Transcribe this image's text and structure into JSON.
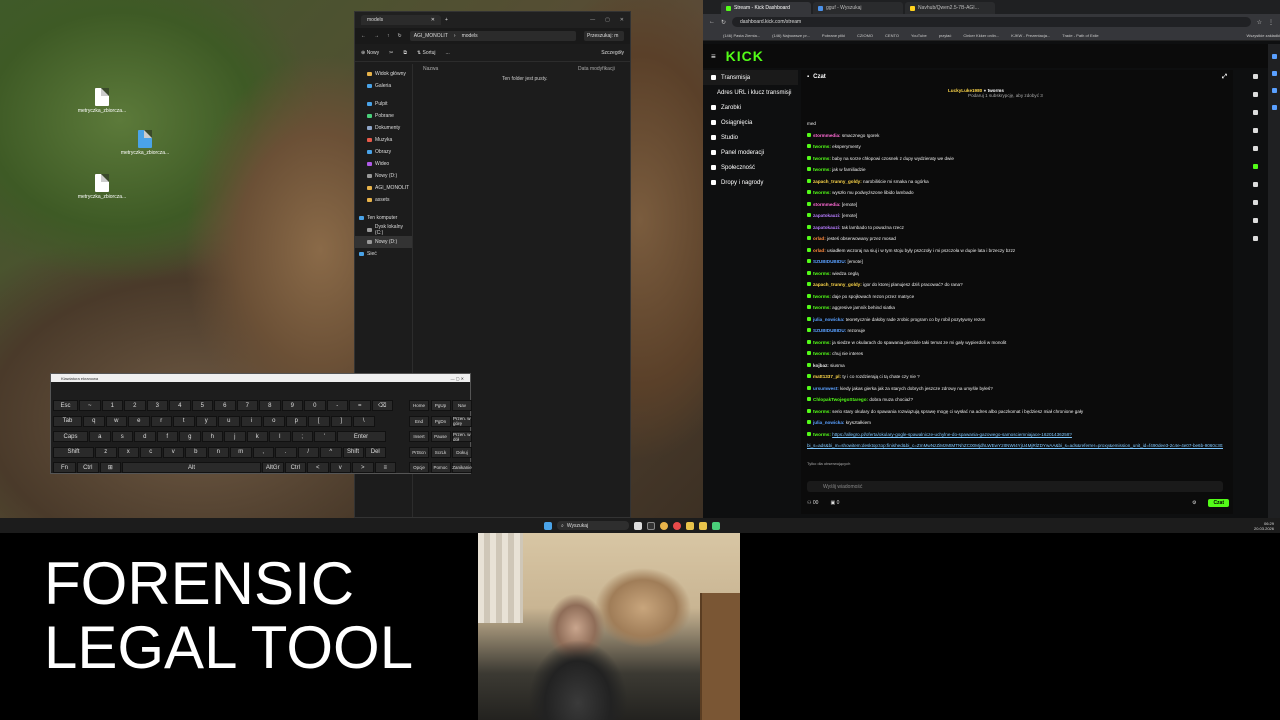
{
  "desktop": {
    "icons": [
      {
        "label": "metryczka_zbiorcza..."
      },
      {
        "label": "metryczka_zbiorcza..."
      },
      {
        "label": "metryczka_zbiorcza..."
      }
    ]
  },
  "explorer": {
    "tab_title": "models",
    "path": [
      "AGI_MONOLIT",
      "models"
    ],
    "search_placeholder": "Przeszukaj: m",
    "toolbar": {
      "new": "Nowy",
      "sort": "Sortuj",
      "more": "...",
      "details": "Szczegóły"
    },
    "sidebar": [
      "Widok główny",
      "Galeria",
      "Pulpit",
      "Pobrane",
      "Dokumenty",
      "Muzyka",
      "Obrazy",
      "Wideo",
      "Nowy (D:)",
      "AGI_MONOLIT",
      "assets",
      "Ten komputer",
      "Dysk lokalny (C:)",
      "Nowy (D:)",
      "Sieć"
    ],
    "columns": {
      "name": "Nazwa",
      "date": "Data modyfikacji"
    },
    "empty_text": "Ten folder jest pusty."
  },
  "keyboard": {
    "title": "Klawiatura ekranowa",
    "row1": [
      "Esc",
      "~",
      "1",
      "2",
      "3",
      "4",
      "5",
      "6",
      "7",
      "8",
      "9",
      "0",
      "-",
      "=",
      "⌫"
    ],
    "row2": [
      "Tab",
      "q",
      "w",
      "e",
      "r",
      "t",
      "y",
      "u",
      "i",
      "o",
      "p",
      "[",
      "]",
      "\\"
    ],
    "row3": [
      "Caps",
      "a",
      "s",
      "d",
      "f",
      "g",
      "h",
      "j",
      "k",
      "l",
      ";",
      "'",
      "Enter"
    ],
    "row4": [
      "Shift",
      "z",
      "x",
      "c",
      "v",
      "b",
      "n",
      "m",
      ",",
      ".",
      "/",
      "^",
      "Shift",
      "Del"
    ],
    "row5": [
      "Fn",
      "Ctrl",
      "⊞",
      "Alt",
      "AltGr",
      "Ctrl",
      "<",
      "v",
      ">",
      "≡"
    ],
    "nav": [
      "Home",
      "PgUp",
      "Nav",
      "End",
      "PgDn",
      "Przen. w górę",
      "Insert",
      "Pause",
      "Przen. w dół",
      "PrtScn",
      "ScrLk",
      "Dokuj",
      "Opcje",
      "Pomoc",
      "Zanikanie"
    ]
  },
  "browser": {
    "tabs": [
      "Stream - Kick Dashboard",
      "gguf - Wyszukaj",
      "Navhub/Qwen2.5-7B-AGI..."
    ],
    "url": "dashboard.kick.com/stream",
    "bookmarks": [
      "(146) Pasta Ziemia...",
      "(146) Najnowsze pr...",
      "Pobrane pliki",
      "CZIOMO",
      "CENTO",
      "YouTube",
      "przyłać",
      "Cinker Kkker onlin...",
      "KJKW - Prezentacja...",
      "Trade - Path of Exile",
      "Wszystkie zakładki"
    ],
    "sidebar": [
      "Transmisja",
      "Adres URL i klucz transmisji",
      "Zarobki",
      "Osiągnięcia",
      "Studio",
      "Panel moderacji",
      "Społeczność",
      "Dropy i nagrody"
    ],
    "chat_title": "Czat",
    "pinned": {
      "user": "LuckyLuke1980",
      "target": "tworms",
      "text": "Podaruj 1 subskrypcję, aby zdobyć 3"
    },
    "messages": [
      {
        "user": "",
        "text": "med",
        "color": "#e8e8e8"
      },
      {
        "user": "stormmedia:",
        "text": "smacznego Igorek",
        "color": "#ff6bd5"
      },
      {
        "user": "tworms:",
        "text": "eksperymenty",
        "color": "#53fc18"
      },
      {
        "user": "tworms:",
        "text": "baby na sorze chłopowi czosnek z dupy wydzieraty we dwie",
        "color": "#53fc18"
      },
      {
        "user": "tworms:",
        "text": "jak w familiadzie",
        "color": "#53fc18"
      },
      {
        "user": "zapach_trunny_goldy:",
        "text": "narobiliście mi smaka na ogórka",
        "color": "#ffd84a"
      },
      {
        "user": "tworms:",
        "text": "wyszło mu podwyższone libido lambado",
        "color": "#53fc18"
      },
      {
        "user": "stormmedia:",
        "text": "[emote]",
        "color": "#ff6bd5"
      },
      {
        "user": "zapatokauzi:",
        "text": "[emote]",
        "color": "#b77cff"
      },
      {
        "user": "zapatokauzi:",
        "text": "tak lambado to poważna rzecz",
        "color": "#b77cff"
      },
      {
        "user": "orlad:",
        "text": "jesteś obserwowany przez mosad",
        "color": "#ff8a3d"
      },
      {
        "user": "orlad:",
        "text": "usiadłem wczoraj na siuj i w tym stoju były pszczoły i mi pszczoła w dupie lata i brzeczy bzzz",
        "color": "#ff8a3d"
      },
      {
        "user": "SZUBIDUBIDU:",
        "text": "[emote]",
        "color": "#5aa0ff"
      },
      {
        "user": "tworms:",
        "text": "wiedza ceglą",
        "color": "#53fc18"
      },
      {
        "user": "zapach_trunny_goldy:",
        "text": "igor do ktorej planujesz dziś pracować? do rana?",
        "color": "#ffd84a"
      },
      {
        "user": "tworms:",
        "text": "daje po spojłowach rezon przez matryce",
        "color": "#53fc18"
      },
      {
        "user": "tworms:",
        "text": "aggresive jamnik behind siatka",
        "color": "#53fc18"
      },
      {
        "user": "julia_nowicka:",
        "text": "teoretycznie dałoby rade zrobic program co by robil pozytywny rezon",
        "color": "#5aa0ff"
      },
      {
        "user": "SZUBIDUBIDU:",
        "text": "rezonuje",
        "color": "#5aa0ff"
      },
      {
        "user": "tworms:",
        "text": "ja siedze w okularach do spawania pierdole taki temat ze mi gały wypierdoli w monolit",
        "color": "#53fc18"
      },
      {
        "user": "tworms:",
        "text": "chuj nie interes",
        "color": "#53fc18"
      },
      {
        "user": "kojbaz:",
        "text": "siusma",
        "color": "#e8e8e8"
      },
      {
        "user": "matt1337_pl:",
        "text": "ty i co rozdzierają ci tą chate czy nie ?",
        "color": "#ffd84a"
      },
      {
        "user": "ursumwest:",
        "text": "kiedy jakas gierka jak za starych dobrych jeszcze zdrowy na umyśle byłeś?",
        "color": "#5aa0ff"
      },
      {
        "user": "ChlopakTwojegoStarego:",
        "text": "dobra muza chociaż?",
        "color": "#53fc18"
      },
      {
        "user": "tworms:",
        "text": "serio stary okulary do spawania rozwiązują sprawę mogę ci wysłać na adres albo paczkomat i będziesz miał chronione gały",
        "color": "#53fc18"
      },
      {
        "user": "julia_nowicka:",
        "text": "kryształkiem",
        "color": "#5aa0ff"
      },
      {
        "user": "tworms:",
        "text": "https://allegro.pl/oferta/okulary-gogle-spawalnicze-uchylne-do-spawania-gazowego-samosciemniajace-16201436258?",
        "color": "#53fc18"
      },
      {
        "user": "",
        "text": "bi_s=ads&bi_m=showitem:desktop:top:finished&bi_c=ZmMwNzZiMzMtMTNhZC00MjdhLWEwY2ItNWI4YjU4MjRlZDYwAA&bi_s=ads&referrer=proxy&emission_unit_id=f490dee3-2c4e-4e07-be6b-9060c3026438",
        "color": "#7ec8ff"
      },
      {
        "user": "julia_nowicka:",
        "text": "Dałoby rade, program uzywalby karty sieciowej ale nie wiem czy to jest legalne",
        "color": "#5aa0ff"
      }
    ],
    "followers_only": "Tylko dla obserwujących",
    "input_placeholder": "Wyślij wiadomość",
    "counters": {
      "a": "00",
      "b": "0"
    },
    "send": "Czat"
  },
  "taskbar": {
    "search": "Wyszukaj",
    "time": "06:29",
    "date": "20.03.2026"
  },
  "overlay": {
    "line1": "FORENSIC",
    "line2": "LEGAL TOOL"
  }
}
